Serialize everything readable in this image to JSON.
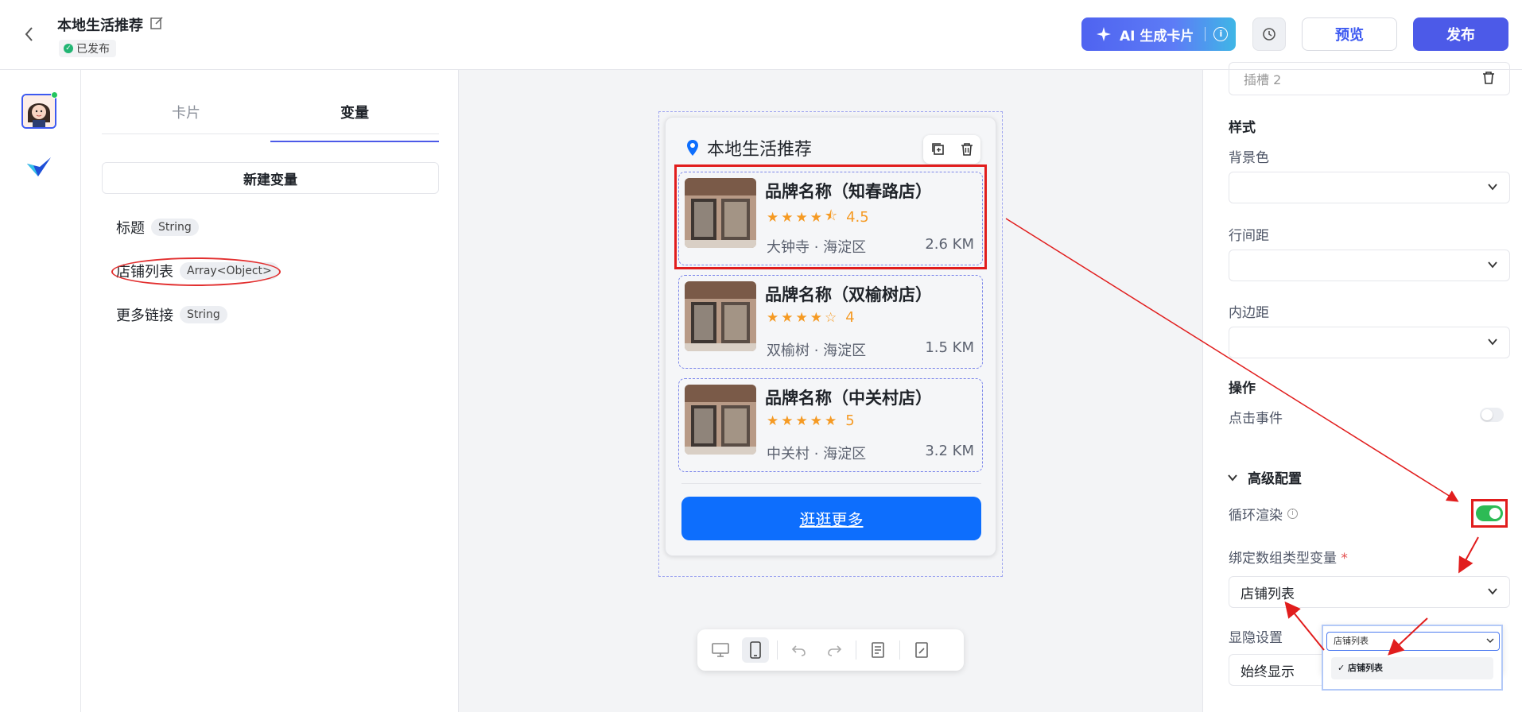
{
  "header": {
    "back_icon": "chevron-left-icon",
    "title": "本地生活推荐",
    "status": "已发布",
    "ai_button": "AI 生成卡片",
    "preview": "预览",
    "publish": "发布"
  },
  "left_panel": {
    "tabs": [
      "卡片",
      "变量"
    ],
    "active_tab": "变量",
    "new_variable": "新建变量",
    "variables": [
      {
        "name": "标题",
        "type": "String"
      },
      {
        "name": "店铺列表",
        "type": "Array<Object>"
      },
      {
        "name": "更多链接",
        "type": "String"
      }
    ]
  },
  "card": {
    "title": "本地生活推荐",
    "shops": [
      {
        "name": "品牌名称（知春路店）",
        "rating": 4.5,
        "score": "4.5",
        "location": "大钟寺 · 海淀区",
        "distance": "2.6 KM"
      },
      {
        "name": "品牌名称（双榆树店）",
        "rating": 4,
        "score": "4",
        "location": "双榆树 · 海淀区",
        "distance": "1.5 KM"
      },
      {
        "name": "品牌名称（中关村店）",
        "rating": 5,
        "score": "5",
        "location": "中关村 · 海淀区",
        "distance": "3.2 KM"
      }
    ],
    "more_button": "逛逛更多"
  },
  "right_panel": {
    "slot_value": "插槽 2",
    "style_section": "样式",
    "background_color": "背景色",
    "line_spacing": "行间距",
    "padding": "内边距",
    "action_section": "操作",
    "click_event": "点击事件",
    "advanced": "高级配置",
    "loop_render": "循环渲染",
    "bind_array_var": "绑定数组类型变量",
    "bind_value": "店铺列表",
    "visibility": "显隐设置",
    "visibility_value": "始终显示",
    "dropdown_selected": "店铺列表",
    "dropdown_option": "店铺列表",
    "loop_render_on": true,
    "click_event_on": false
  },
  "colors": {
    "accent": "#4c5ae8",
    "card_button": "#0d6efd",
    "star": "#f59a23",
    "annotation_red": "#e11d1d"
  }
}
